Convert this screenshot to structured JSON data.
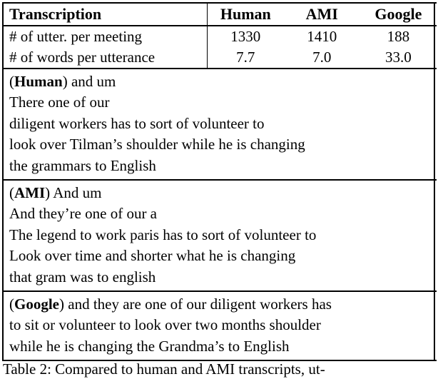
{
  "table": {
    "header": {
      "label": "Transcription",
      "columns": [
        "Human",
        "AMI",
        "Google"
      ]
    },
    "stats": [
      {
        "label": "# of utter. per meeting",
        "values": [
          "1330",
          "1410",
          "188"
        ]
      },
      {
        "label": "# of words per utterance",
        "values": [
          "7.7",
          "7.0",
          "33.0"
        ]
      }
    ],
    "blocks": [
      {
        "speaker": "Human",
        "prefix_open": "(",
        "prefix_close": ")",
        "first_line_rest": " and um",
        "lines": [
          "There one of our",
          "diligent workers has to sort of volunteer to",
          "look over Tilman’s shoulder while he is changing",
          "the grammars to English"
        ]
      },
      {
        "speaker": "AMI",
        "prefix_open": "(",
        "prefix_close": ")",
        "first_line_rest": " And um",
        "lines": [
          "And they’re one of our a",
          "The legend to work paris has to sort of volunteer to",
          "Look over time and shorter what he is changing",
          "that gram was to english"
        ]
      },
      {
        "speaker": "Google",
        "prefix_open": "(",
        "prefix_close": ")",
        "first_line_rest": " and they are one of our diligent workers has",
        "lines": [
          "to sit or volunteer to look over two months shoulder",
          "while he is changing the Grandma’s to English"
        ]
      }
    ]
  },
  "caption": {
    "text": "Table 2: Compared to human and AMI transcripts, ut-"
  }
}
